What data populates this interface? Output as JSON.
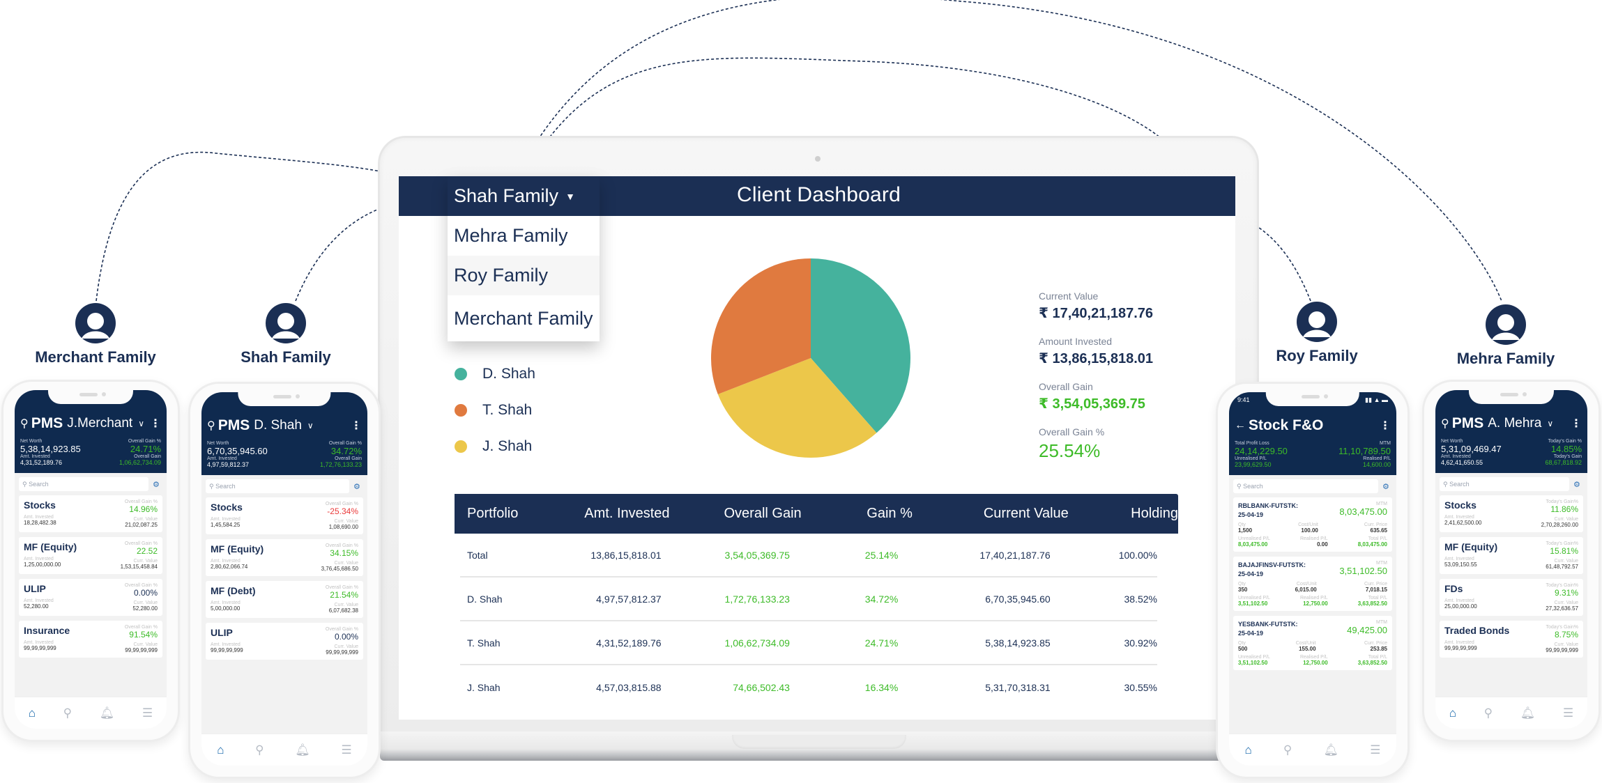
{
  "families": [
    {
      "label": "Merchant Family"
    },
    {
      "label": "Shah Family"
    },
    {
      "label": "Roy Family"
    },
    {
      "label": "Mehra Family"
    }
  ],
  "dashboard": {
    "title": "Client Dashboard",
    "dropdown": {
      "selected": "Shah Family",
      "caret": "▼",
      "options": [
        "Mehra Family",
        "Roy Family",
        "Merchant Family"
      ]
    },
    "legend": [
      {
        "label": "D. Shah",
        "color": "#45b29d"
      },
      {
        "label": "T. Shah",
        "color": "#e07a3f"
      },
      {
        "label": "J. Shah",
        "color": "#ecc74a"
      }
    ],
    "summary": {
      "current_value_label": "Current Value",
      "current_value": "₹ 17,40,21,187.76",
      "amount_invested_label": "Amount Invested",
      "amount_invested": "₹ 13,86,15,818.01",
      "overall_gain_label": "Overall Gain",
      "overall_gain": "₹ 3,54,05,369.75",
      "overall_gain_pct_label": "Overall Gain %",
      "overall_gain_pct": "25.54%"
    },
    "table": {
      "headers": [
        "Portfolio",
        "Amt. Invested",
        "Overall Gain",
        "Gain %",
        "Current Value",
        "Holding"
      ],
      "rows": [
        [
          "Total",
          "13,86,15,818.01",
          "3,54,05,369.75",
          "25.14%",
          "17,40,21,187.76",
          "100.00%"
        ],
        [
          "D. Shah",
          "4,97,57,812.37",
          "1,72,76,133.23",
          "34.72%",
          "6,70,35,945.60",
          "38.52%"
        ],
        [
          "T. Shah",
          "4,31,52,189.76",
          "1,06,62,734.09",
          "24.71%",
          "5,38,14,923.85",
          "30.92%"
        ],
        [
          "J. Shah",
          "4,57,03,815.88",
          "74,66,502.43",
          "16.34%",
          "5,31,70,318.31",
          "30.55%"
        ]
      ]
    }
  },
  "chart_data": {
    "type": "pie",
    "title": "",
    "categories": [
      "D. Shah",
      "T. Shah",
      "J. Shah"
    ],
    "values": [
      38.52,
      30.92,
      30.55
    ],
    "colors": [
      "#45b29d",
      "#e07a3f",
      "#ecc74a"
    ]
  },
  "phones": {
    "merchant": {
      "app": "PMS",
      "client": "J.Merchant",
      "net_worth_label": "Net Worth",
      "net_worth": "5,38,14,923.85",
      "gain_pct_label": "Overall Gain %",
      "gain_pct": "24.71%",
      "invested_label": "Amt. Invested",
      "invested": "4,31,52,189.76",
      "gain_label": "Overall Gain",
      "gain": "1,06,62,734.09",
      "search_placeholder": "Search",
      "cards": [
        {
          "name": "Stocks",
          "gain_label": "Overall Gain %",
          "gain": "14.96%",
          "tone": "green",
          "inv_label": "Amt. Invested",
          "inv": "18,28,482.38",
          "cur_label": "Curr. Value",
          "cur": "21,02,087.25"
        },
        {
          "name": "MF (Equity)",
          "gain_label": "Overall Gain %",
          "gain": "22.52",
          "tone": "green",
          "inv_label": "Amt. Invested",
          "inv": "1,25,00,000.00",
          "cur_label": "Curr. Value",
          "cur": "1,53,15,458.84"
        },
        {
          "name": "ULIP",
          "gain_label": "Overall Gain %",
          "gain": "0.00%",
          "tone": "neutral",
          "inv_label": "Amt. Invested",
          "inv": "52,280.00",
          "cur_label": "Curr. Value",
          "cur": "52,280.00"
        },
        {
          "name": "Insurance",
          "gain_label": "Overall Gain %",
          "gain": "91.54%",
          "tone": "green",
          "inv_label": "Amt. Invested",
          "inv": "99,99,99,999",
          "cur_label": "Curr. Value",
          "cur": "99,99,99,999"
        }
      ]
    },
    "shah": {
      "app": "PMS",
      "client": "D. Shah",
      "net_worth_label": "Net Worth",
      "net_worth": "6,70,35,945.60",
      "gain_pct_label": "Overall Gain %",
      "gain_pct": "34.72%",
      "invested_label": "Amt. Invested",
      "invested": "4,97,59,812.37",
      "gain_label": "Overall Gain",
      "gain": "1,72,76,133.23",
      "search_placeholder": "Search",
      "cards": [
        {
          "name": "Stocks",
          "gain_label": "Overall Gain %",
          "gain": "-25.34%",
          "tone": "red",
          "inv_label": "Amt. Invested",
          "inv": "1,45,584.25",
          "cur_label": "Curr. Value",
          "cur": "1,08,690.00"
        },
        {
          "name": "MF (Equity)",
          "gain_label": "Overall Gain %",
          "gain": "34.15%",
          "tone": "green",
          "inv_label": "Amt. Invested",
          "inv": "2,80,62,066.74",
          "cur_label": "Curr. Value",
          "cur": "3,76,45,686.50"
        },
        {
          "name": "MF (Debt)",
          "gain_label": "Overall Gain %",
          "gain": "21.54%",
          "tone": "green",
          "inv_label": "Amt. Invested",
          "inv": "5,00,000.00",
          "cur_label": "Curr. Value",
          "cur": "6,07,682.38"
        },
        {
          "name": "ULIP",
          "gain_label": "Overall Gain %",
          "gain": "0.00%",
          "tone": "neutral",
          "inv_label": "Amt. Invested",
          "inv": "99,99,99,999",
          "cur_label": "Curr. Value",
          "cur": "99,99,99,999"
        }
      ]
    },
    "roy": {
      "time": "9:41",
      "title": "Stock F&O",
      "total_pl_label": "Total Profit Loss",
      "total_pl": "24,14,229.50",
      "mtm_label": "MTM",
      "mtm": "11,10,789.50",
      "unrealised_label": "Unrealised P/L",
      "unrealised": "23,99,629.50",
      "realised_label": "Realised P/L",
      "realised": "14,600.00",
      "search_placeholder": "Search",
      "labels": {
        "mtm": "MTM",
        "qty": "Qty",
        "cost": "Cost/Unit",
        "price": "Curr. Price",
        "upl": "Unrealised P/L",
        "rpl": "Realised P/L",
        "tpl": "Total P/L"
      },
      "cards": [
        {
          "name": "RBLBANK-FUTSTK:",
          "date": "25-04-19",
          "mtm": "8,03,475.00",
          "qty": "1,500",
          "cost": "100.00",
          "price": "635.65",
          "upl": "8,03,475.00",
          "rpl": "0.00",
          "tpl": "8,03,475.00"
        },
        {
          "name": "BAJAJFINSV-FUTSTK:",
          "date": "25-04-19",
          "mtm": "3,51,102.50",
          "qty": "350",
          "cost": "6,015.00",
          "price": "7,018.15",
          "upl": "3,51,102.50",
          "rpl": "12,750.00",
          "tpl": "3,63,852.50"
        },
        {
          "name": "YESBANK-FUTSTK:",
          "date": "25-04-19",
          "mtm": "49,425.00",
          "qty": "500",
          "cost": "155.00",
          "price": "253.85",
          "upl": "3,51,102.50",
          "rpl": "12,750.00",
          "tpl": "3,63,852.50"
        }
      ]
    },
    "mehra": {
      "app": "PMS",
      "client": "A. Mehra",
      "net_worth_label": "Net Worth",
      "net_worth": "5,31,09,469.47",
      "gain_pct_label": "Today's Gain %",
      "gain_pct": "14.85%",
      "invested_label": "Amt. Invested",
      "invested": "4,62,41,650.55",
      "gain_label": "Today's Gain",
      "gain": "68,67,818.92",
      "search_placeholder": "Search",
      "cards": [
        {
          "name": "Stocks",
          "gain_label": "Today's Gain%",
          "gain": "11.86%",
          "tone": "green",
          "inv_label": "Amt. Invested",
          "inv": "2,41,62,500.00",
          "cur_label": "Curr. Value",
          "cur": "2,70,28,260.00"
        },
        {
          "name": "MF (Equity)",
          "gain_label": "Today's Gain%",
          "gain": "15.81%",
          "tone": "green",
          "inv_label": "Amt. Invested",
          "inv": "53,09,150.55",
          "cur_label": "Curr. Value",
          "cur": "61,48,792.57"
        },
        {
          "name": "FDs",
          "gain_label": "Today's Gain%",
          "gain": "9.31%",
          "tone": "green",
          "inv_label": "Amt. Invested",
          "inv": "25,00,000.00",
          "cur_label": "Curr. Value",
          "cur": "27,32,636.57"
        },
        {
          "name": "Traded Bonds",
          "gain_label": "Today's Gain%",
          "gain": "8.75%",
          "tone": "green",
          "inv_label": "Amt. Invested",
          "inv": "99,99,99,999",
          "cur_label": "Curr. Value",
          "cur": "99,99,99,999"
        }
      ]
    },
    "nav_icons": [
      "home-icon",
      "search-icon",
      "bell-icon",
      "menu-icon"
    ]
  }
}
